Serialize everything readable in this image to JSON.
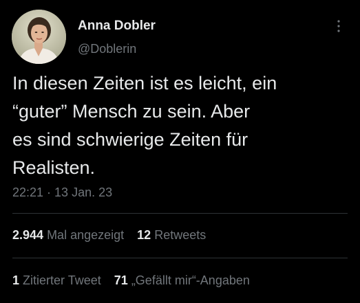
{
  "author": {
    "display_name": "Anna Dobler",
    "handle": "@Doblerin"
  },
  "tweet": {
    "text_lines": [
      "In diesen Zeiten ist es leicht, ein",
      "“guter” Mensch zu sein. Aber",
      "es sind schwierige Zeiten für",
      "Realisten."
    ],
    "timestamp": "22:21 · 13 Jan. 23"
  },
  "stats": {
    "views": {
      "count": "2.944",
      "label": "Mal angezeigt"
    },
    "retweets": {
      "count": "12",
      "label": "Retweets"
    },
    "quotes": {
      "count": "1",
      "label": "Zitierter Tweet"
    },
    "likes": {
      "count": "71",
      "label": "„Gefällt mir“-Angaben"
    }
  },
  "icons": {
    "more": "more-vertical-icon"
  },
  "colors": {
    "background": "#000000",
    "primary_text": "#e7e9ea",
    "secondary_text": "#71767b",
    "divider": "#2f3336"
  }
}
